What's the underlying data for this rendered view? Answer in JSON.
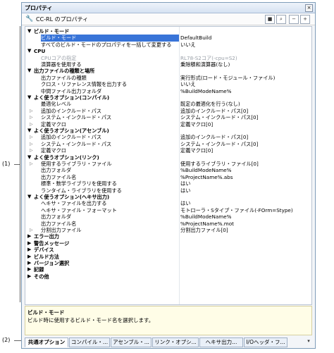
{
  "callouts": {
    "one": "(1)",
    "two": "(2)"
  },
  "window": {
    "title": "プロパティ",
    "close_glyph": "×"
  },
  "toolbar": {
    "title": "CC-RL のプロパティ",
    "btn_lock": "■",
    "btn_search": "⌕",
    "btn_minus": "−",
    "btn_plus": "+"
  },
  "rows": [
    {
      "type": "cat",
      "tw": "▼",
      "name": "ビルド・モード",
      "value": ""
    },
    {
      "type": "sub sel",
      "tw": "",
      "name": "ビルド・モード",
      "value": "DefaultBuild"
    },
    {
      "type": "sub",
      "tw": "",
      "name": "すべてのビルド・モードのプロパティを一括して変更する",
      "value": "いいえ"
    },
    {
      "type": "cat",
      "tw": "▼",
      "name": "CPU",
      "value": ""
    },
    {
      "type": "sub gray",
      "tw": "",
      "name": "CPUコアの指定",
      "value": "RL78-S2コア(-cpu=S2)"
    },
    {
      "type": "sub",
      "tw": "",
      "name": "演算器を使用する",
      "value": "乗除積和演算器(なし)"
    },
    {
      "type": "cat",
      "tw": "▼",
      "name": "出力ファイルの種類と場所",
      "value": ""
    },
    {
      "type": "sub",
      "tw": "",
      "name": "出力ファイルの種類",
      "value": "実行形式(ロード・モジュール・ファイル)"
    },
    {
      "type": "sub",
      "tw": "",
      "name": "クロス・リファレンス情報を出力する",
      "value": "いいえ"
    },
    {
      "type": "sub",
      "tw": "",
      "name": "中間ファイル出力フォルダ",
      "value": "%BuildModeName%"
    },
    {
      "type": "cat",
      "tw": "▼",
      "name": "よく使うオプション(コンパイル)",
      "value": ""
    },
    {
      "type": "sub",
      "tw": "",
      "name": "最適化レベル",
      "value": "既定の最適化を行う(なし)"
    },
    {
      "type": "sub",
      "tw": "▷",
      "name": "追加のインクルード・パス",
      "value": "追加のインクルード・パス[0]"
    },
    {
      "type": "sub",
      "tw": "▷",
      "name": "システム・インクルード・パス",
      "value": "システム・インクルード・パス[0]"
    },
    {
      "type": "sub",
      "tw": "▷",
      "name": "定義マクロ",
      "value": "定義マクロ[0]"
    },
    {
      "type": "cat",
      "tw": "▼",
      "name": "よく使うオプション(アセンブル)",
      "value": ""
    },
    {
      "type": "sub",
      "tw": "▷",
      "name": "追加のインクルード・パス",
      "value": "追加のインクルード・パス[0]"
    },
    {
      "type": "sub",
      "tw": "▷",
      "name": "システム・インクルード・パス",
      "value": "システム・インクルード・パス[0]"
    },
    {
      "type": "sub",
      "tw": "▷",
      "name": "定義マクロ",
      "value": "定義マクロ[0]"
    },
    {
      "type": "cat",
      "tw": "▼",
      "name": "よく使うオプション(リンク)",
      "value": ""
    },
    {
      "type": "sub",
      "tw": "▷",
      "name": "使用するライブラリ・ファイル",
      "value": "使用するライブラリ・ファイル[0]"
    },
    {
      "type": "sub",
      "tw": "",
      "name": "出力フォルダ",
      "value": "%BuildModeName%"
    },
    {
      "type": "sub",
      "tw": "",
      "name": "出力ファイル名",
      "value": "%ProjectName%.abs"
    },
    {
      "type": "sub",
      "tw": "",
      "name": "標準・数学ライブラリを使用する",
      "value": "はい"
    },
    {
      "type": "sub",
      "tw": "",
      "name": "ランタイム・ライブラリを使用する",
      "value": "はい"
    },
    {
      "type": "cat",
      "tw": "▼",
      "name": "よく使うオプション(ヘキサ出力)",
      "value": ""
    },
    {
      "type": "sub",
      "tw": "",
      "name": "ヘキサ・ファイルを出力する",
      "value": "はい"
    },
    {
      "type": "sub",
      "tw": "",
      "name": "ヘキサ・ファイル・フォーマット",
      "value": "モトローラ・Sタイプ・ファイル(-FOrm=Stype)"
    },
    {
      "type": "sub",
      "tw": "",
      "name": "出力フォルダ",
      "value": "%BuildModeName%"
    },
    {
      "type": "sub",
      "tw": "",
      "name": "出力ファイル名",
      "value": "%ProjectName%.mot"
    },
    {
      "type": "sub",
      "tw": "▷",
      "name": "分割出力ファイル",
      "value": "分割出力ファイル[0]"
    },
    {
      "type": "cat",
      "tw": "▶",
      "name": "エラー出力",
      "value": ""
    },
    {
      "type": "cat",
      "tw": "▶",
      "name": "警告メッセージ",
      "value": ""
    },
    {
      "type": "cat",
      "tw": "▶",
      "name": "デバイス",
      "value": ""
    },
    {
      "type": "cat",
      "tw": "▶",
      "name": "ビルド方法",
      "value": ""
    },
    {
      "type": "cat",
      "tw": "▶",
      "name": "バージョン選択",
      "value": ""
    },
    {
      "type": "cat",
      "tw": "▶",
      "name": "記録",
      "value": ""
    },
    {
      "type": "cat",
      "tw": "▶",
      "name": "その他",
      "value": ""
    }
  ],
  "description": {
    "heading": "ビルド・モード",
    "body": "ビルド時に使用するビルド・モード名を選択します。"
  },
  "tabs": [
    "共通オプション",
    "コンパイル・...",
    "アセンブル・...",
    "リンク・オプシ...",
    "ヘキサ出力...",
    "I/Oヘッダ・フ..."
  ],
  "tab_more": "▾"
}
